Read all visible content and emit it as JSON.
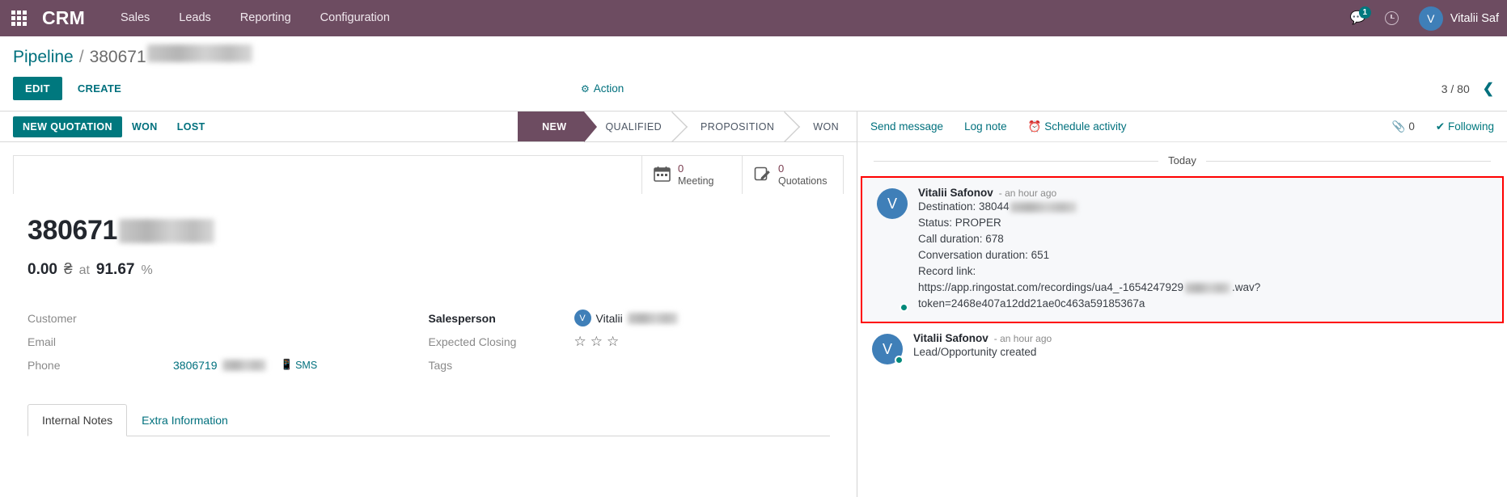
{
  "navbar": {
    "apps_icon": "apps-grid-icon",
    "brand": "CRM",
    "menus": [
      "Sales",
      "Leads",
      "Reporting",
      "Configuration"
    ],
    "messages_icon": "chat-bubble-icon",
    "messages_count": "1",
    "activities_icon": "clock-icon",
    "user_initial": "V",
    "user_name": "Vitalii Saf",
    "bg_color": "#6d4c61"
  },
  "control_panel": {
    "breadcrumb_root": "Pipeline",
    "breadcrumb_separator": "/",
    "breadcrumb_current": "380671",
    "edit_label": "EDIT",
    "create_label": "CREATE",
    "action_icon": "gear-icon",
    "action_label": "Action",
    "pager_value": "3 / 80",
    "pager_prev_icon": "chevron-left-icon"
  },
  "statusbar": {
    "buttons": [
      {
        "label": "NEW QUOTATION",
        "primary": true
      },
      {
        "label": "WON",
        "primary": false
      },
      {
        "label": "LOST",
        "primary": false
      }
    ],
    "stages": [
      {
        "label": "NEW",
        "active": true
      },
      {
        "label": "QUALIFIED",
        "active": false
      },
      {
        "label": "PROPOSITION",
        "active": false
      },
      {
        "label": "WON",
        "active": false
      }
    ]
  },
  "smart_buttons": [
    {
      "icon": "calendar-icon",
      "value": "0",
      "label": "Meeting"
    },
    {
      "icon": "quotation-icon",
      "value": "0",
      "label": "Quotations"
    }
  ],
  "record": {
    "title": "380671",
    "amount": "0.00",
    "currency": "₴",
    "at_word": "at",
    "probability": "91.67",
    "percent_symbol": "%"
  },
  "fields_left": [
    {
      "label": "Customer",
      "value": "",
      "bold": false
    },
    {
      "label": "Email",
      "value": "",
      "bold": false
    },
    {
      "label": "Phone",
      "value": "3806719",
      "bold": false,
      "sms_icon": "sms-icon",
      "sms_label": "SMS"
    }
  ],
  "fields_right": [
    {
      "label": "Salesperson",
      "value": "Vitalii",
      "bold": true,
      "avatar_initial": "V"
    },
    {
      "label": "Expected Closing",
      "value": "",
      "bold": false,
      "stars": 3
    },
    {
      "label": "Tags",
      "value": "",
      "bold": false
    }
  ],
  "notebook_tabs": [
    {
      "label": "Internal Notes",
      "active": true
    },
    {
      "label": "Extra Information",
      "active": false
    }
  ],
  "chatter": {
    "send_message": "Send message",
    "log_note": "Log note",
    "schedule_icon": "clock-icon",
    "schedule_activity": "Schedule activity",
    "attachment_icon": "paperclip-icon",
    "attachment_count": "0",
    "following_icon": "check-icon",
    "following_label": "Following",
    "day_separator": "Today",
    "messages": [
      {
        "avatar_initial": "V",
        "author": "Vitalii Safonov",
        "time": "- an hour ago",
        "highlighted": true,
        "lines": [
          "Destination: 38044",
          "Status: PROPER",
          "Call duration: 678",
          "Conversation duration: 651",
          "Record link:"
        ],
        "url_part1": "https://app.ringostat.com/recordings/ua4_-1654247929",
        "url_part2": ".wav?",
        "url_part3": "token=2468e407a12dd21ae0c463a59185367a"
      },
      {
        "avatar_initial": "V",
        "author": "Vitalii Safonov",
        "time": "- an hour ago",
        "highlighted": false,
        "lines": [
          "Lead/Opportunity created"
        ]
      }
    ]
  },
  "colors": {
    "brand_purple": "#6d4c61",
    "accent_teal": "#00787e",
    "link_teal": "#00707d",
    "highlight_red": "#ff0000",
    "avatar_blue": "#3f7fb8"
  }
}
